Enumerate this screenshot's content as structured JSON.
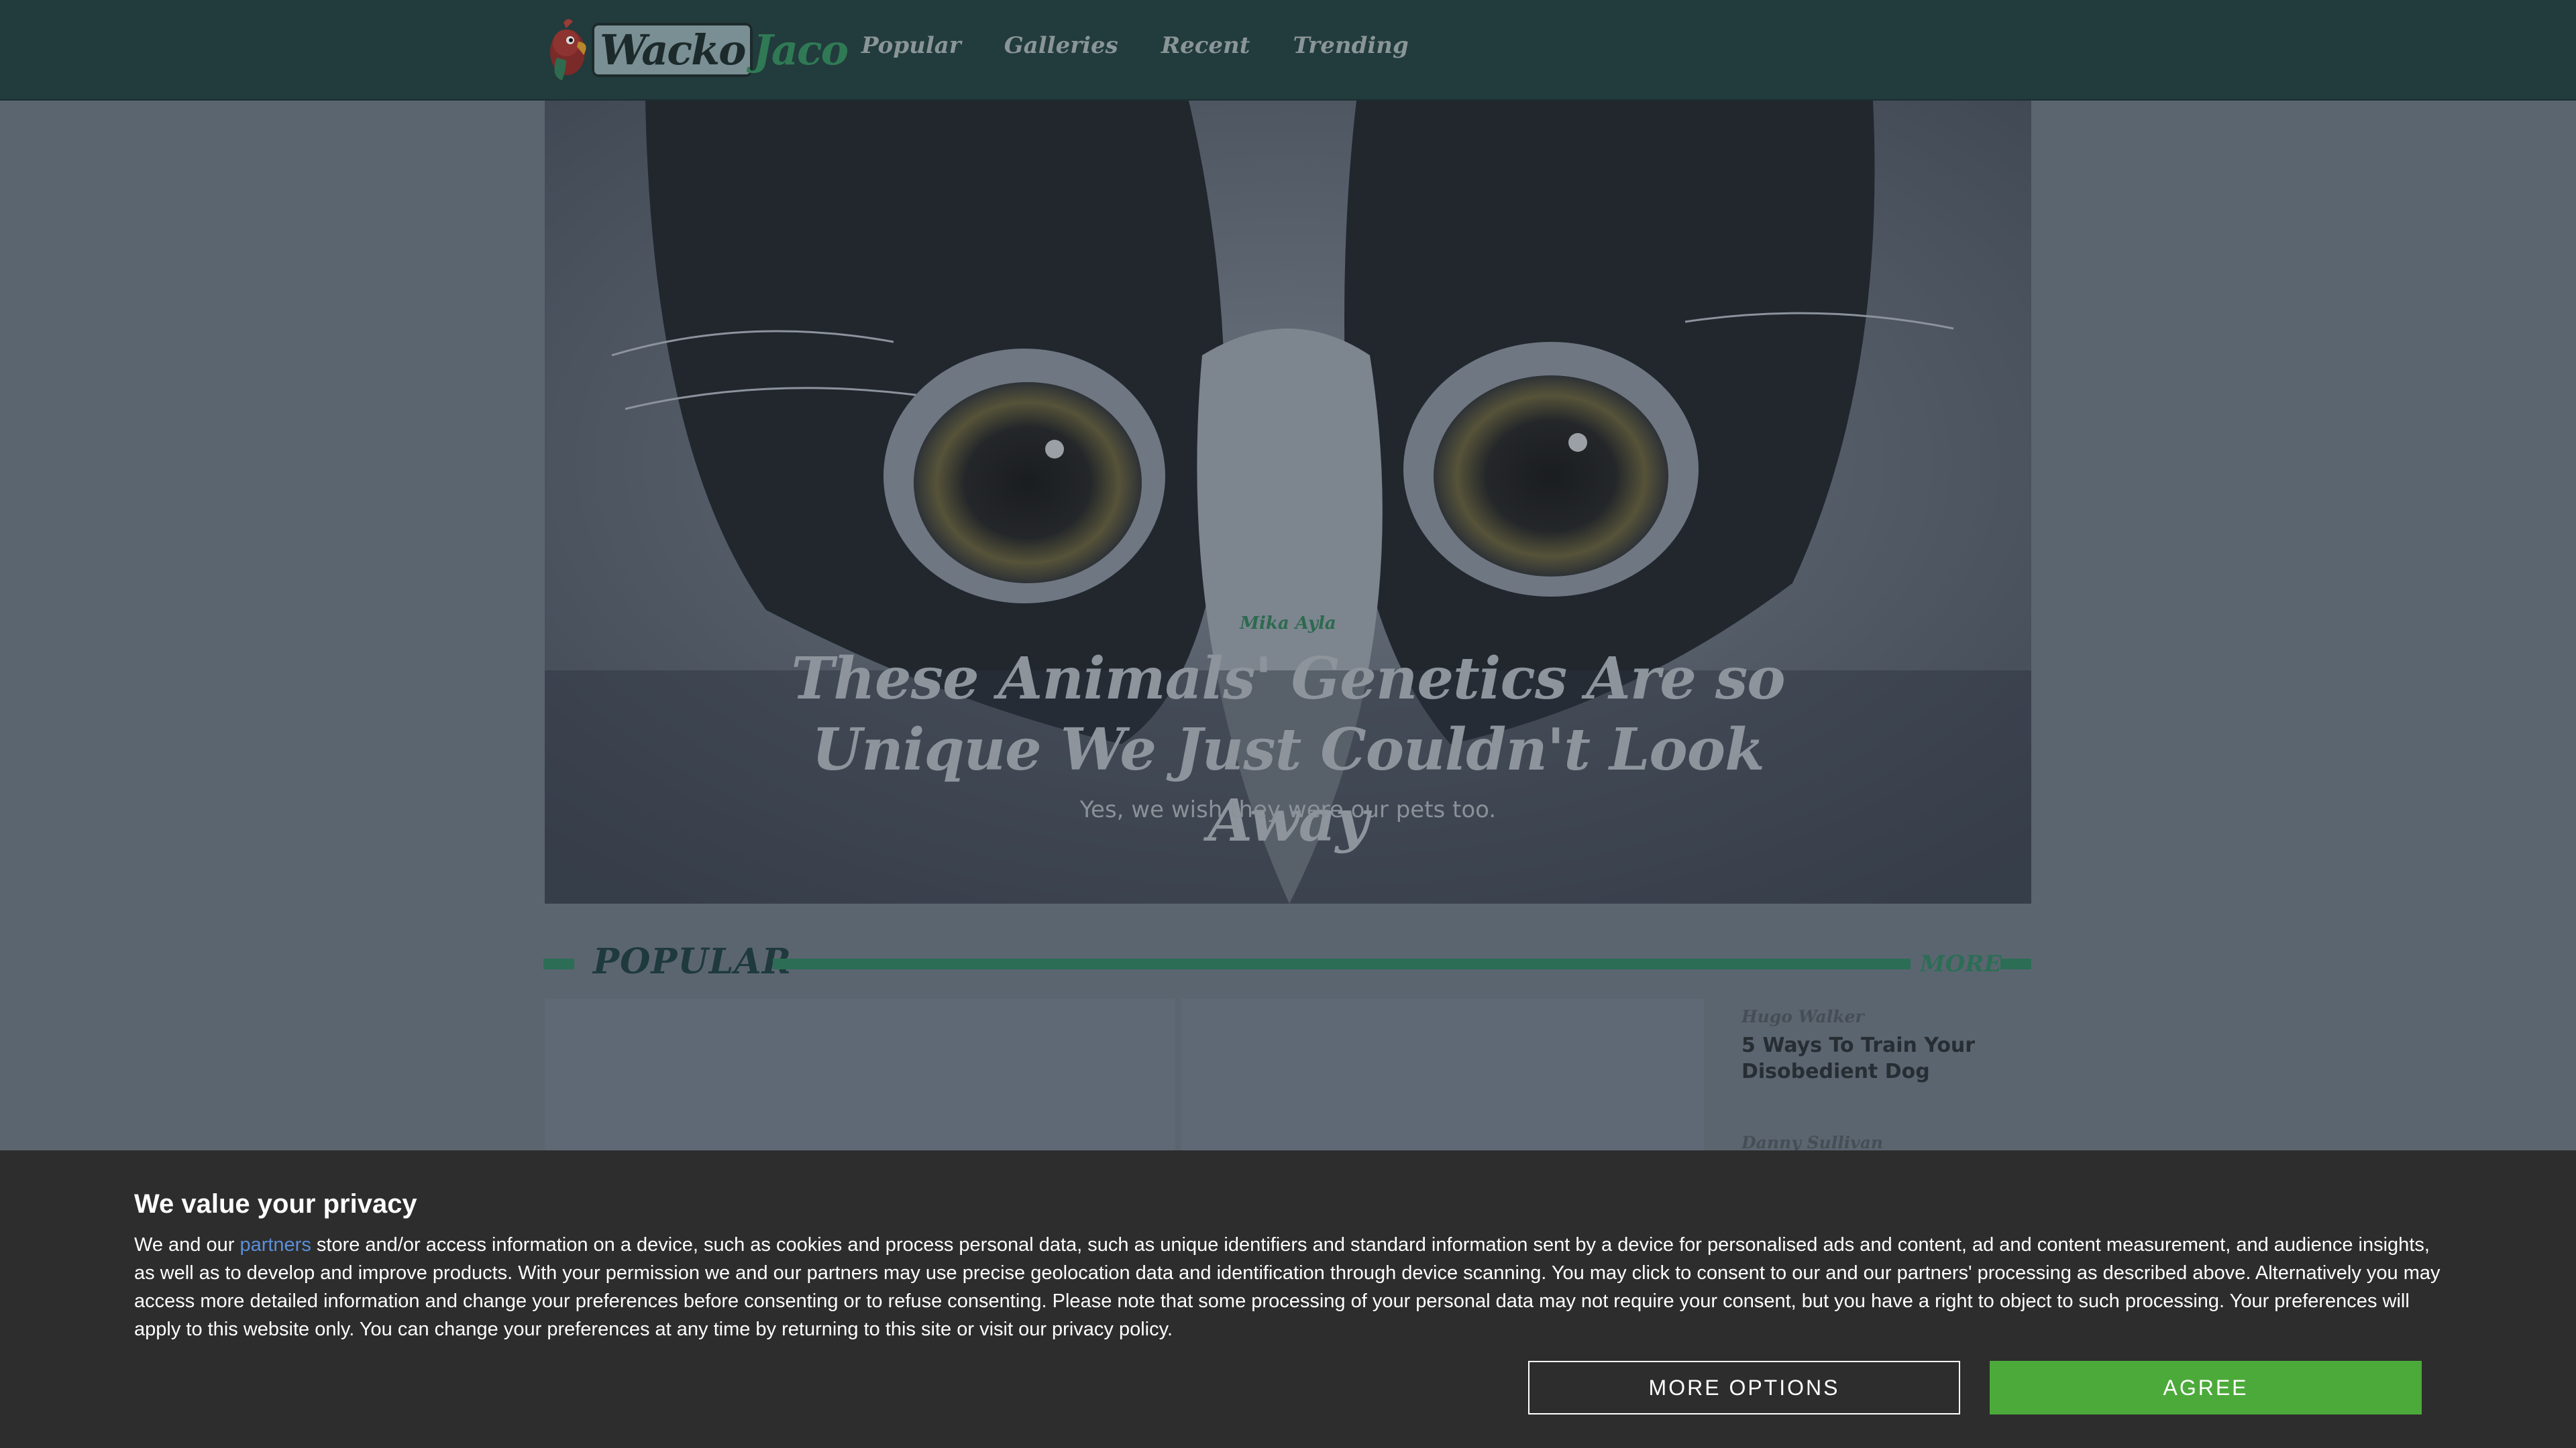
{
  "header": {
    "logo": {
      "text_part1": "Wacko",
      "text_part2": "Jaco",
      "icon": "parrot-icon"
    },
    "nav": [
      "Popular",
      "Galleries",
      "Recent",
      "Trending"
    ]
  },
  "hero": {
    "author": "Mika Ayla",
    "title": "These Animals' Genetics Are so Unique We Just Couldn't Look Away",
    "subtitle": "Yes, we wish they were our pets too."
  },
  "popular": {
    "heading": "POPULAR",
    "more_label": "MORE",
    "side_articles": [
      {
        "author": "Hugo Walker",
        "title": "5 Ways To Train Your Disobedient Dog"
      },
      {
        "author": "Danny Sullivan",
        "title": ""
      }
    ]
  },
  "consent": {
    "heading": "We value your privacy",
    "text_before_link": "We and our ",
    "link_text": "partners",
    "text_after_link": " store and/or access information on a device, such as cookies and process personal data, such as unique identifiers and standard information sent by a device for personalised ads and content, ad and content measurement, and audience insights, as well as to develop and improve products. With your permission we and our partners may use precise geolocation data and identification through device scanning. You may click to consent to our and our partners' processing as described above. Alternatively you may access more detailed information and change your preferences before consenting or to refuse consenting. Please note that some processing of your personal data may not require your consent, but you have a right to object to such processing. Your preferences will apply to this website only. You can change your preferences at any time by returning to this site or visit our privacy policy.",
    "more_options_label": "MORE OPTIONS",
    "agree_label": "AGREE"
  },
  "colors": {
    "header_bg": "#223b3c",
    "accent_green": "#2b6e55",
    "agree_green": "#4caa3a",
    "consent_bg": "#2d2d2d"
  }
}
